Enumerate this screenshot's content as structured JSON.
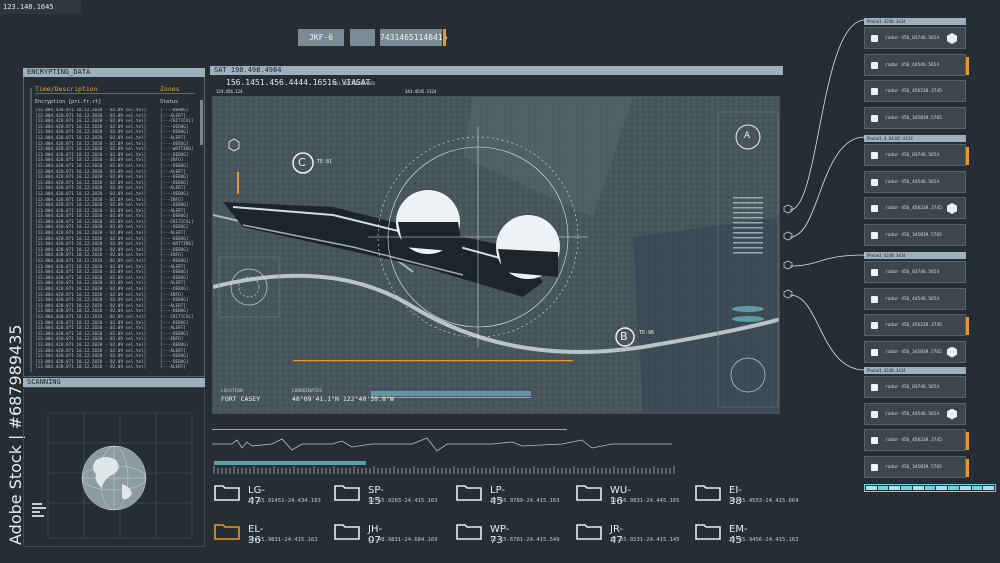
{
  "top_id": "123.148.1645",
  "chips": {
    "code": "JKF-6",
    "number": "74314651148415"
  },
  "log_panel": {
    "title": "ENCRYPTING_DATA",
    "col_time": "Time/Description",
    "col_zones": "Zones",
    "sub_left": "Encryption [pri.fr.rt]",
    "sub_right": "Status",
    "rows": [
      [
        "[13.004.420.071 18.12.2020 - 02.09 sel.tel]",
        "[----DEBUG]"
      ],
      [
        "[13.004.420.071 18.12.2020 - 02.09 sel.tel]",
        "[---ALERT]"
      ],
      [
        "[13.004.420.071 18.12.2020 - 02.09 sel.tel]",
        "[---CRITICAL]"
      ],
      [
        "[13.004.420.071 18.12.2020 - 02.09 sel.tel]",
        "[----DEBUG]"
      ],
      [
        "[13.004.420.071 18.12.2020 - 02.09 sel.tel]",
        "[----DEBUG]"
      ],
      [
        "[13.004.420.071 18.12.2020 - 02.09 sel.tel]",
        "[---ALERT]"
      ],
      [
        "[13.004.420.071 18.12.2020 - 02.09 sel.tel]",
        "[----DEBUG]"
      ],
      [
        "[13.004.420.071 18.12.2020 - 02.09 sel.tel]",
        "[----WATTING]"
      ],
      [
        "[13.004.420.071 18.12.2020 - 02.09 sel.tel]",
        "[----DEBUG]"
      ],
      [
        "[13.004.420.071 18.12.2020 - 02.09 sel.tel]",
        "[---INFO]"
      ],
      [
        "[13.004.420.071 18.12.2020 - 02.09 sel.tel]",
        "[----DEBUG]"
      ],
      [
        "[13.004.420.071 18.12.2020 - 02.09 sel.tel]",
        "[---ALERT]"
      ],
      [
        "[13.004.420.071 18.12.2020 - 02.09 sel.tel]",
        "[----DEBUG]"
      ],
      [
        "[13.004.420.071 18.12.2020 - 02.09 sel.tel]",
        "[----DEBUG]"
      ],
      [
        "[13.004.420.071 18.12.2020 - 02.09 sel.tel]",
        "[---ALERT]"
      ],
      [
        "[13.004.420.071 18.12.2020 - 02.09 sel.tel]",
        "[----DEBUG]"
      ],
      [
        "[13.004.420.071 18.12.2020 - 02.09 sel.tel]",
        "[---INFO]"
      ],
      [
        "[13.004.420.071 18.12.2020 - 02.09 sel.tel]",
        "[----DEBUG]"
      ],
      [
        "[13.004.420.071 18.12.2020 - 02.09 sel.tel]",
        "[---ALERT]"
      ],
      [
        "[13.004.420.071 18.12.2020 - 02.09 sel.tel]",
        "[----DEBUG]"
      ],
      [
        "[13.004.420.071 18.12.2020 - 02.09 sel.tel]",
        "[---CRITICAL]"
      ],
      [
        "[13.004.420.071 18.12.2020 - 02.09 sel.tel]",
        "[----DEBUG]"
      ],
      [
        "[13.004.420.071 18.12.2020 - 02.09 sel.tel]",
        "[---ALERT]"
      ],
      [
        "[13.004.420.071 18.12.2020 - 02.09 sel.tel]",
        "[----DEBUG]"
      ],
      [
        "[13.004.420.071 18.12.2020 - 02.09 sel.tel]",
        "[----WATTING]"
      ],
      [
        "[13.004.420.071 18.12.2020 - 02.09 sel.tel]",
        "[----DEBUG]"
      ],
      [
        "[13.004.420.071 18.12.2020 - 02.09 sel.tel]",
        "[---INFO]"
      ],
      [
        "[13.004.420.071 18.12.2020 - 02.09 sel.tel]",
        "[----DEBUG]"
      ],
      [
        "[13.004.420.071 18.12.2020 - 02.09 sel.tel]",
        "[---ALERT]"
      ],
      [
        "[13.004.420.071 18.12.2020 - 02.09 sel.tel]",
        "[----DEBUG]"
      ],
      [
        "[13.004.420.071 18.12.2020 - 02.09 sel.tel]",
        "[----DEBUG]"
      ],
      [
        "[13.004.420.071 18.12.2020 - 02.09 sel.tel]",
        "[---ALERT]"
      ],
      [
        "[13.004.420.071 18.12.2020 - 02.09 sel.tel]",
        "[----DEBUG]"
      ],
      [
        "[13.004.420.071 18.12.2020 - 02.09 sel.tel]",
        "[---INFO]"
      ],
      [
        "[13.004.420.071 18.12.2020 - 02.09 sel.tel]",
        "[----DEBUG]"
      ],
      [
        "[13.004.420.071 18.12.2020 - 02.09 sel.tel]",
        "[---ALERT]"
      ],
      [
        "[13.004.420.071 18.12.2020 - 02.09 sel.tel]",
        "[----DEBUG]"
      ],
      [
        "[13.004.420.071 18.12.2020 - 02.09 sel.tel]",
        "[---CRITICAL]"
      ],
      [
        "[13.004.420.071 18.12.2020 - 02.09 sel.tel]",
        "[----DEBUG]"
      ],
      [
        "[13.004.420.071 18.12.2020 - 02.09 sel.tel]",
        "[---ALERT]"
      ],
      [
        "[13.004.420.071 18.12.2020 - 02.09 sel.tel]",
        "[----DEBUG]"
      ],
      [
        "[13.004.420.071 18.12.2020 - 02.09 sel.tel]",
        "[---INFO]"
      ],
      [
        "[13.004.420.071 18.12.2020 - 02.09 sel.tel]",
        "[----DEBUG]"
      ],
      [
        "[13.004.420.071 18.12.2020 - 02.09 sel.tel]",
        "[---ALERT]"
      ],
      [
        "[13.004.420.071 18.12.2020 - 02.09 sel.tel]",
        "[----DEBUG]"
      ],
      [
        "[13.004.420.071 18.12.2020 - 02.09 sel.tel]",
        "[----DEBUG]"
      ],
      [
        "[13.004.420.071 18.12.2020 - 02.09 sel.tel]",
        "[---ALERT]"
      ]
    ]
  },
  "scan_panel": {
    "title": "SCANNING"
  },
  "sat_panel": {
    "title": "SAT 198.498.4984",
    "subtitle": "156.1451.456.4444.16516 VIASAT",
    "subtitle_tag": "ALL_ACTIVEEERASED",
    "top_labels": [
      "124.456.124",
      "343.4545.5324",
      "393.343.12",
      "LDR.67",
      "365.34455.18324"
    ],
    "marker_c": "C",
    "marker_a": "A",
    "marker_b": "B",
    "marker_c_label": "TE-81",
    "marker_b_label": "TE-96",
    "location_label": "LOCATION",
    "location_value": "FORT CASEY",
    "coord_label": "COORDINATES",
    "coord_value": "48°09'41.1\"N 122°40'39.8\"W"
  },
  "nodes": {
    "groups": [
      {
        "title": "Phone3_4248.3434",
        "items": [
          "radar 456_83746.5654",
          "radar 456_44546.5654",
          "radar 456_456238.3745",
          "radar 456_345839.5765"
        ]
      },
      {
        "title": "Phone3_4_84345.8534",
        "items": [
          "radar 456_83746.5654",
          "radar 456_44546.5654",
          "radar 456_456238.3745",
          "radar 456_345839.5765"
        ]
      },
      {
        "title": "Phone3_4248.3434",
        "items": [
          "radar 456_83746.5654",
          "radar 456_44546.5654",
          "radar 456_456238.3745",
          "radar 456_345839.5765"
        ]
      },
      {
        "title": "Phone3_4248.3434",
        "items": [
          "radar 456_83746.5654",
          "radar 456_44546.5654",
          "radar 456_456238.3745",
          "radar 456_345839.5765"
        ]
      }
    ]
  },
  "folders": [
    {
      "name": "LG-47",
      "coord": "12.65.91451-24.434.163"
    },
    {
      "name": "SP-15",
      "coord": "12.65.9283-24.415.163"
    },
    {
      "name": "LP-45",
      "coord": "12.65.9789-24.415.163"
    },
    {
      "name": "WU-16",
      "coord": "12.66.9831-24.445.165"
    },
    {
      "name": "EI-38",
      "coord": "12.65.4553-24.415.664"
    },
    {
      "name": "EL-36",
      "coord": "12.65.9831-24.415.163"
    },
    {
      "name": "JH-07",
      "coord": "12.48.9831-24.684.169"
    },
    {
      "name": "WP-73",
      "coord": "12.55.6781-24.415.549"
    },
    {
      "name": "JR-47",
      "coord": "12.65.9231-24.415.145"
    },
    {
      "name": "EM-45",
      "coord": "12.65.9456-24.415.163"
    }
  ],
  "side_text": "Adobe Stock | #687989435",
  "colors": {
    "accent": "#e39a2a",
    "panel": "#3b464e",
    "header": "#9eb0bc",
    "cyan": "#6fd3de"
  }
}
